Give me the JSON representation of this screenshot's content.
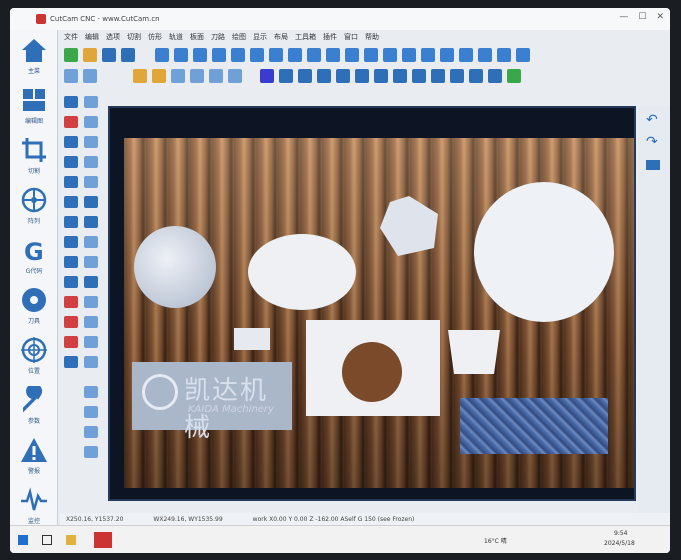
{
  "window": {
    "title": "CutCam CNC - www.CutCam.cn"
  },
  "sidebar": {
    "items": [
      {
        "label": "主菜",
        "icon": "home-icon"
      },
      {
        "label": "编辑图",
        "icon": "layout-icon"
      },
      {
        "label": "切割",
        "icon": "crop-icon"
      },
      {
        "label": "阵列",
        "icon": "network-icon"
      },
      {
        "label": "G代码",
        "icon": "g-code-icon"
      },
      {
        "label": "刀具",
        "icon": "saw-blade-icon"
      },
      {
        "label": "位置",
        "icon": "target-icon"
      },
      {
        "label": "参数",
        "icon": "wrench-icon"
      },
      {
        "label": "警报",
        "icon": "warning-icon"
      },
      {
        "label": "监控",
        "icon": "pulse-icon"
      }
    ]
  },
  "menu": [
    "文件",
    "编辑",
    "选项",
    "切割",
    "仿形",
    "轨道",
    "板面",
    "刀路",
    "绘图",
    "显示",
    "布局",
    "工具箱",
    "插件",
    "窗口",
    "帮助"
  ],
  "canvas": {
    "logo_text": "凯达机械",
    "logo_sub": "KAIDA Machinery"
  },
  "status": {
    "coord1": "X250.16, Y1537.20",
    "coord2": "WX249.16, WY1535.99",
    "info": "work X0.00 Y 0.00 Z -162.00 ASelf G 150 (see Frozen)"
  },
  "taskbar": {
    "weather": "16°C 晴",
    "time": "9:54",
    "date": "2024/5/18"
  },
  "colors": {
    "accent": "#2f6fb7",
    "canvas_bg": "#0d1524"
  }
}
